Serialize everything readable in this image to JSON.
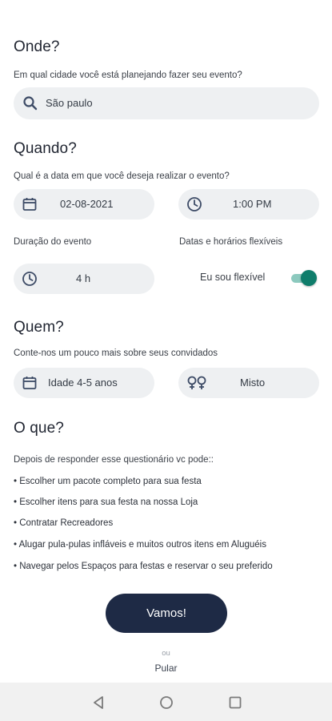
{
  "onde": {
    "title": "Onde?",
    "subtitle": "Em qual cidade você está planejando fazer seu evento?",
    "search_value": "São paulo",
    "icon": "search-icon"
  },
  "quando": {
    "title": "Quando?",
    "subtitle": "Qual é a data em que você deseja realizar o evento?",
    "date": "02-08-2021",
    "time": "1:00 PM",
    "duration_label": "Duração do evento",
    "flex_label": "Datas e horários flexíveis",
    "duration_value": "4 h",
    "flex_toggle_label": "Eu sou flexível",
    "flex_on": true,
    "accent_color": "#0f7d6b"
  },
  "quem": {
    "title": "Quem?",
    "subtitle": "Conte-nos um pouco mais sobre seus convidados",
    "age": "Idade 4-5 anos",
    "gender": "Misto"
  },
  "oque": {
    "title": "O que?",
    "intro": "Depois de responder esse questionário vc pode::",
    "items": [
      "• Escolher um pacote completo para sua festa",
      "• Escolher itens para sua festa na nossa Loja",
      "• Contratar Recreadores",
      "• Alugar pula-pulas infláveis e muitos outros itens em Aluguéis",
      "• Navegar pelos Espaços para festas e reservar o seu preferido"
    ]
  },
  "actions": {
    "primary": "Vamos!",
    "or": "ou",
    "skip": "Pular",
    "primary_color": "#1e2a45"
  }
}
